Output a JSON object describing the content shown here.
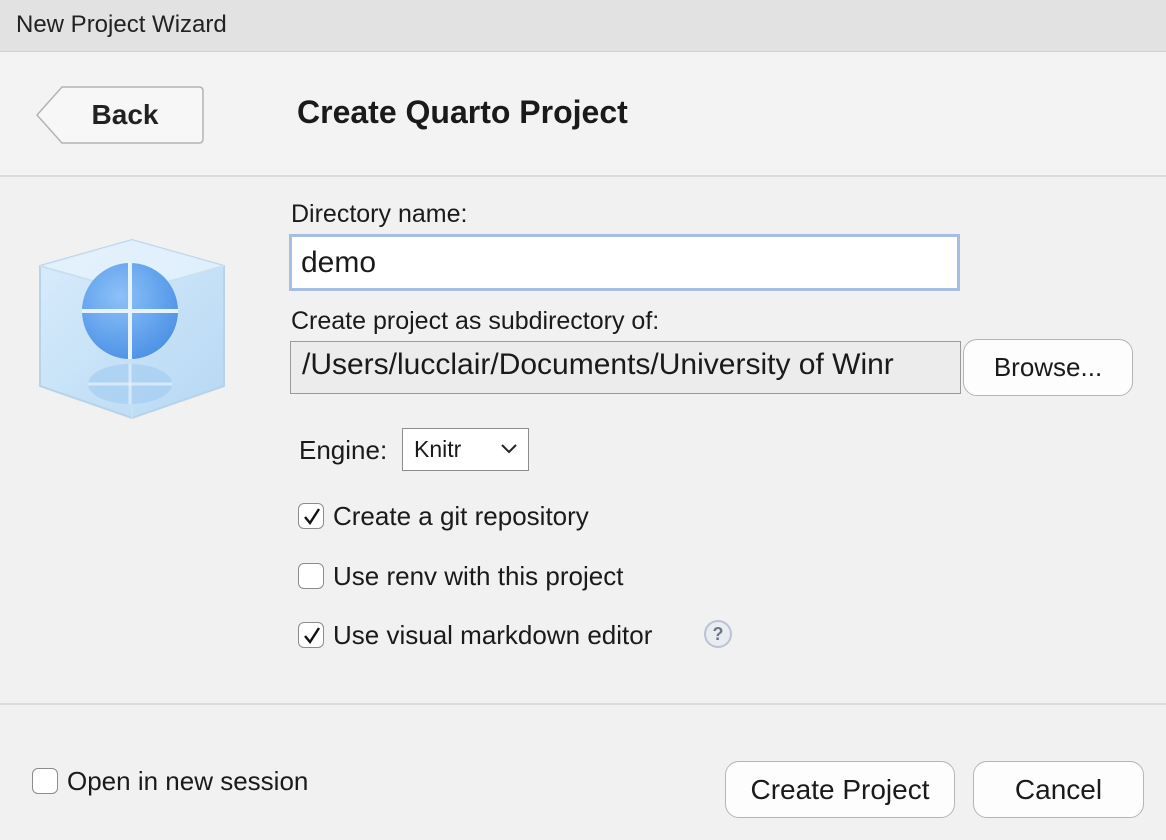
{
  "window": {
    "title": "New Project Wizard"
  },
  "header": {
    "back_label": "Back",
    "title": "Create Quarto Project"
  },
  "form": {
    "directory_label": "Directory name:",
    "directory_value": "demo",
    "parent_label": "Create project as subdirectory of:",
    "parent_value": "/Users/lucclair/Documents/University of Winr",
    "browse_label": "Browse...",
    "engine_label": "Engine:",
    "engine_value": "Knitr",
    "options": [
      {
        "label": "Create a git repository",
        "checked": true
      },
      {
        "label": "Use renv with this project",
        "checked": false
      },
      {
        "label": "Use visual markdown editor",
        "checked": true
      }
    ],
    "help_glyph": "?"
  },
  "footer": {
    "open_session_label": "Open in new session",
    "open_session_checked": false,
    "create_label": "Create Project",
    "cancel_label": "Cancel"
  },
  "icons": [
    "quarto-logo-icon",
    "checkmark-icon",
    "chevron-down-icon",
    "help-icon"
  ],
  "colors": {
    "input_focus_border": "#a4bfe3",
    "logo_blue": "#5b9df0"
  }
}
